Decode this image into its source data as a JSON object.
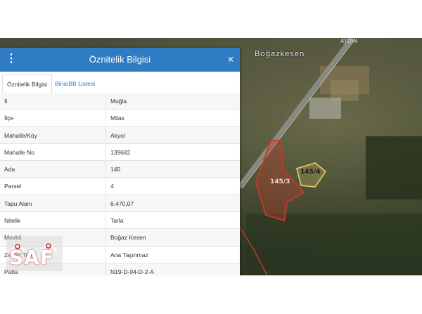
{
  "panel": {
    "title": "Öznitelik Bilgisi",
    "close_icon": "×",
    "tabs": [
      {
        "label": "Öznitelik Bilgisi",
        "active": true
      },
      {
        "label": "Bina/BB Listesi",
        "active": false
      }
    ]
  },
  "attributes": [
    {
      "key": "İl",
      "value": "Muğla"
    },
    {
      "key": "İlçe",
      "value": "Milas"
    },
    {
      "key": "Mahalle/Köy",
      "value": "Akyol"
    },
    {
      "key": "Mahalle No",
      "value": "139682"
    },
    {
      "key": "Ada",
      "value": "145"
    },
    {
      "key": "Parsel",
      "value": "4"
    },
    {
      "key": "Tapu Alanı",
      "value": "6.470,07"
    },
    {
      "key": "Nitelik",
      "value": "Tarla"
    },
    {
      "key": "Mevkii",
      "value": "Boğaz Kesen"
    },
    {
      "key": "Zemin Tipi",
      "value": "Ana Taşınmaz"
    },
    {
      "key": "Pafta",
      "value": "N19-D-04-D-2-A"
    }
  ],
  "map": {
    "place_label": "Boğazkesen",
    "road_label": "AYDIN",
    "parcel_selected_label": "145/3",
    "parcel_other_label": "145/4",
    "selected_color": "#c0392b",
    "other_color": "#e0c060"
  },
  "logo": {
    "text": "SAF"
  },
  "colors": {
    "header": "#2f7cc2",
    "accent_bar": "#3aa54a"
  }
}
